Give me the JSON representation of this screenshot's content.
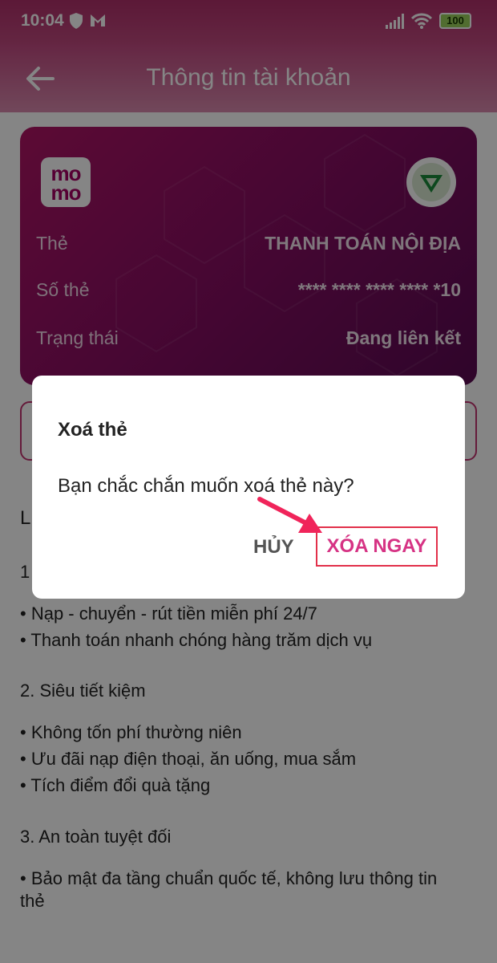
{
  "status_bar": {
    "time": "10:04",
    "battery": "100"
  },
  "app_bar": {
    "title": "Thông tin tài khoản"
  },
  "card": {
    "logo_text_top": "mo",
    "logo_text_bottom": "mo",
    "rows": [
      {
        "label": "Thẻ",
        "value": "THANH TOÁN NỘI ĐỊA"
      },
      {
        "label": "Số thẻ",
        "value": "**** **** **** **** *10"
      },
      {
        "label": "Trạng thái",
        "value": "Đang liên kết"
      }
    ]
  },
  "content": {
    "heading_fragment": "L",
    "section1_fragment": "1",
    "section1_bullets": [
      "• Nạp - chuyển - rút tiền miễn phí 24/7",
      "• Thanh toán nhanh chóng hàng trăm dịch vụ"
    ],
    "section2_title": "2. Siêu tiết kiệm",
    "section2_bullets": [
      "• Không tốn phí thường niên",
      "• Ưu đãi nạp điện thoại, ăn uống, mua sắm",
      "• Tích điểm đổi quà tặng"
    ],
    "section3_title": "3. An toàn tuyệt đối",
    "section3_bullet_line1": "• Bảo mật đa tầng chuẩn quốc tế, không lưu thông tin",
    "section3_bullet_line2": "thẻ"
  },
  "dialog": {
    "title": "Xoá thẻ",
    "message": "Bạn chắc chắn muốn xoá thẻ này?",
    "cancel_label": "HỦY",
    "confirm_label": "XÓA NGAY"
  },
  "colors": {
    "brand": "#a50064",
    "annotation": "#f0245a"
  }
}
